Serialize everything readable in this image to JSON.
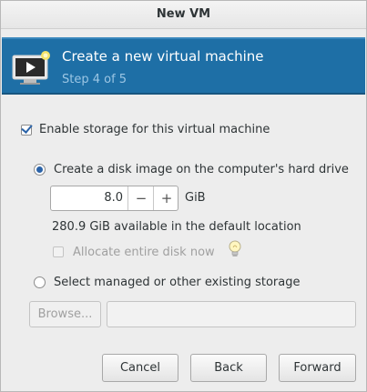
{
  "window": {
    "title": "New VM"
  },
  "header": {
    "title": "Create a new virtual machine",
    "step": "Step 4 of 5",
    "icon": "vm-monitor-icon",
    "accent_color": "#1e6fa6"
  },
  "storage": {
    "enable_label": "Enable storage for this virtual machine",
    "enable_checked": true,
    "create_disk_label": "Create a disk image on the computer's hard drive",
    "create_disk_selected": true,
    "disk_size_value": "8.0",
    "decrement_label": "−",
    "increment_label": "+",
    "unit_label": "GiB",
    "available_text": "280.9 GiB available in the default location",
    "allocate_label": "Allocate entire disk now",
    "allocate_checked": false,
    "existing_label": "Select managed or other existing storage",
    "existing_selected": false,
    "browse_label": "Browse...",
    "path_value": ""
  },
  "buttons": {
    "cancel": "Cancel",
    "back": "Back",
    "forward": "Forward"
  }
}
